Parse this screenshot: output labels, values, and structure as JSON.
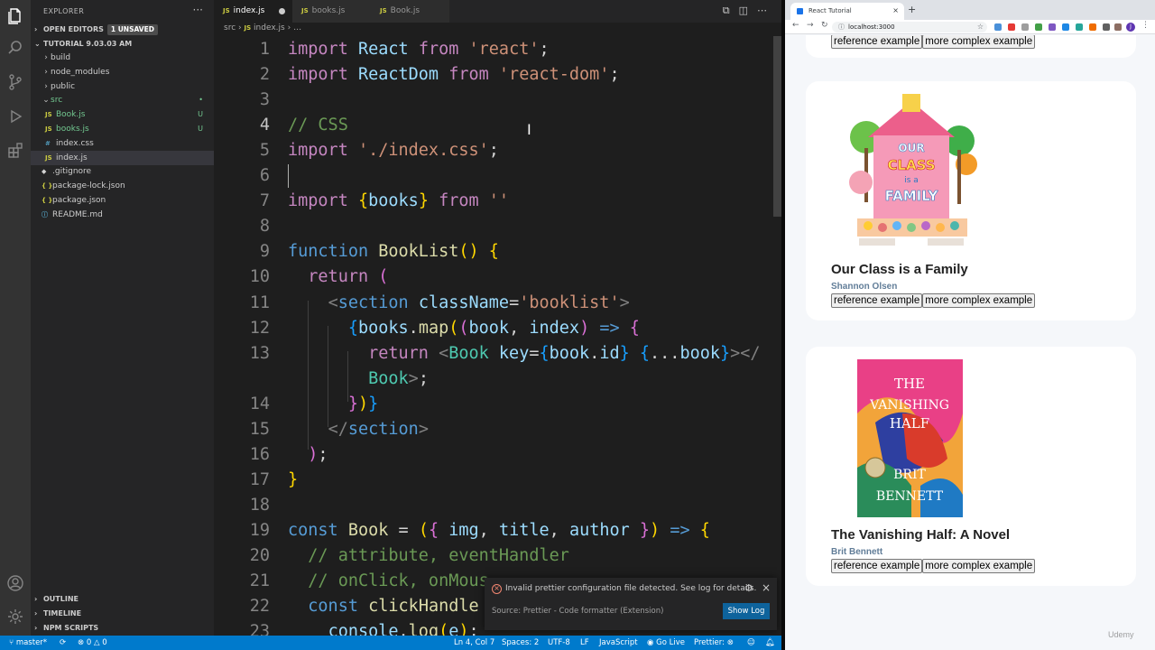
{
  "vscode": {
    "explorer_title": "EXPLORER",
    "more": "···",
    "open_editors": {
      "label": "OPEN EDITORS",
      "badge": "1 UNSAVED"
    },
    "workspace": "TUTORIAL 9.03.03 AM",
    "tree": [
      {
        "label": "build",
        "type": "folder",
        "open": false,
        "indent": 1
      },
      {
        "label": "node_modules",
        "type": "folder",
        "open": false,
        "indent": 1
      },
      {
        "label": "public",
        "type": "folder",
        "open": false,
        "indent": 1
      },
      {
        "label": "src",
        "type": "folder",
        "open": true,
        "indent": 1,
        "git": "•"
      },
      {
        "label": "Book.js",
        "type": "js",
        "indent": 2,
        "git": "U"
      },
      {
        "label": "books.js",
        "type": "js",
        "indent": 2,
        "git": "U"
      },
      {
        "label": "index.css",
        "type": "css",
        "indent": 2
      },
      {
        "label": "index.js",
        "type": "js",
        "indent": 2,
        "selected": true
      },
      {
        "label": ".gitignore",
        "type": "git",
        "indent": 1
      },
      {
        "label": "package-lock.json",
        "type": "json",
        "indent": 1
      },
      {
        "label": "package.json",
        "type": "json",
        "indent": 1
      },
      {
        "label": "README.md",
        "type": "info",
        "indent": 1
      }
    ],
    "bottom_sections": [
      "OUTLINE",
      "TIMELINE",
      "NPM SCRIPTS"
    ],
    "tabs": [
      {
        "label": "index.js",
        "active": true,
        "dirty": true
      },
      {
        "label": "books.js",
        "active": false
      },
      {
        "label": "Book.js",
        "active": false
      }
    ],
    "tab_icon": "JS",
    "breadcrumb": {
      "folder": "src",
      "sep": "›",
      "file": "index.js",
      "rest": "…"
    },
    "notification": {
      "message": "Invalid prettier configuration file detected. See log for details.",
      "source": "Source: Prettier - Code formatter (Extension)",
      "button": "Show Log"
    },
    "status": {
      "branch": "master*",
      "errors": "0",
      "warnings": "0",
      "position": "Ln 4, Col 7",
      "spaces": "Spaces: 2",
      "encoding": "UTF-8",
      "eol": "LF",
      "language": "JavaScript",
      "golive": "Go Live",
      "prettier": "Prettier:"
    }
  },
  "code_lines": [
    {
      "n": "1",
      "html": "<span class='kw'>import</span> <span class='var'>React</span> <span class='kw'>from</span> <span class='str'>'react'</span><span class='plain'>;</span>"
    },
    {
      "n": "2",
      "html": "<span class='kw'>import</span> <span class='var'>ReactDom</span> <span class='kw'>from</span> <span class='str'>'react-dom'</span><span class='plain'>;</span>"
    },
    {
      "n": "3",
      "html": ""
    },
    {
      "n": "4",
      "html": "<span class='cmt'>// CSS</span>",
      "current": true
    },
    {
      "n": "5",
      "html": "<span class='kw'>import</span> <span class='str'>'./index.css'</span><span class='plain'>;</span>"
    },
    {
      "n": "6",
      "html": ""
    },
    {
      "n": "7",
      "html": "<span class='kw'>import</span> <span class='br1'>{</span><span class='var'>books</span><span class='br1'>}</span> <span class='kw'>from</span> <span class='str'>''</span>"
    },
    {
      "n": "8",
      "html": ""
    },
    {
      "n": "9",
      "html": "<span class='kw2'>function</span> <span class='fn'>BookList</span><span class='br1'>()</span> <span class='br1'>{</span>"
    },
    {
      "n": "10",
      "html": "  <span class='kw'>return</span> <span class='br2'>(</span>"
    },
    {
      "n": "11",
      "html": "    <span class='tag'>&lt;</span><span class='kw2'>section</span> <span class='var'>className</span><span class='plain'>=</span><span class='str'>'booklist'</span><span class='tag'>&gt;</span>"
    },
    {
      "n": "12",
      "html": "      <span class='br3'>{</span><span class='var'>books</span><span class='plain'>.</span><span class='fn'>map</span><span class='br1'>(</span><span class='br2'>(</span><span class='var'>book</span><span class='plain'>, </span><span class='var'>index</span><span class='br2'>)</span> <span class='kw2'>=&gt;</span> <span class='br2'>{</span>"
    },
    {
      "n": "13",
      "html": "        <span class='kw'>return</span> <span class='tag'>&lt;</span><span class='cls'>Book</span> <span class='var'>key</span><span class='plain'>=</span><span class='br3'>{</span><span class='var'>book</span><span class='plain'>.</span><span class='var'>id</span><span class='br3'>}</span> <span class='br3'>{</span><span class='plain'>...</span><span class='var'>book</span><span class='br3'>}</span><span class='tag'>&gt;&lt;/</span>"
    },
    {
      "n": "",
      "html": "        <span class='cls'>Book</span><span class='tag'>&gt;</span><span class='plain'>;</span>"
    },
    {
      "n": "14",
      "html": "      <span class='br2'>}</span><span class='br1'>)</span><span class='br3'>}</span>"
    },
    {
      "n": "15",
      "html": "    <span class='tag'>&lt;/</span><span class='kw2'>section</span><span class='tag'>&gt;</span>"
    },
    {
      "n": "16",
      "html": "  <span class='br2'>)</span><span class='plain'>;</span>"
    },
    {
      "n": "17",
      "html": "<span class='br1'>}</span>"
    },
    {
      "n": "18",
      "html": ""
    },
    {
      "n": "19",
      "html": "<span class='kw2'>const</span> <span class='fn'>Book</span> <span class='plain'>=</span> <span class='br1'>(</span><span class='br2'>{</span> <span class='var'>img</span><span class='plain'>, </span><span class='var'>title</span><span class='plain'>, </span><span class='var'>author</span> <span class='br2'>}</span><span class='br1'>)</span> <span class='kw2'>=&gt;</span> <span class='br1'>{</span>"
    },
    {
      "n": "20",
      "html": "  <span class='cmt'>// attribute, eventHandler</span>"
    },
    {
      "n": "21",
      "html": "  <span class='cmt'>// onClick, onMous</span>"
    },
    {
      "n": "22",
      "html": "  <span class='kw2'>const</span> <span class='fn'>clickHandle</span>"
    },
    {
      "n": "23",
      "html": "    <span class='var'>console</span><span class='plain'>.</span><span class='fn'>log</span><span class='br1'>(</span><span class='var'>e</span><span class='br1'>)</span><span class='plain'>;</span>"
    }
  ],
  "browser": {
    "tab_title": "React Tutorial",
    "tab_close": "×",
    "new_tab": "+",
    "url": "localhost:3000",
    "avatar": "J",
    "cards": [
      {
        "title": "",
        "author": "",
        "btn1": "reference example",
        "btn2": "more complex example",
        "cover": ""
      },
      {
        "title": "Our Class is a Family",
        "author": "Shannon Olsen",
        "btn1": "reference example",
        "btn2": "more complex example",
        "cover": "our-class"
      },
      {
        "title": "The Vanishing Half: A Novel",
        "author": "Brit Bennett",
        "btn1": "reference example",
        "btn2": "more complex example",
        "cover": "vanishing"
      }
    ],
    "cover_text": {
      "our_class": [
        "OUR",
        "CLASS",
        "is a",
        "FAMILY"
      ],
      "vanishing": [
        "THE",
        "VANISHING",
        "HALF",
        "BRIT",
        "BENNETT"
      ]
    }
  },
  "watermark": "Udemy",
  "colors": {
    "accent": "#007acc",
    "author": "#617d98",
    "button_blue": "#0e639c"
  }
}
